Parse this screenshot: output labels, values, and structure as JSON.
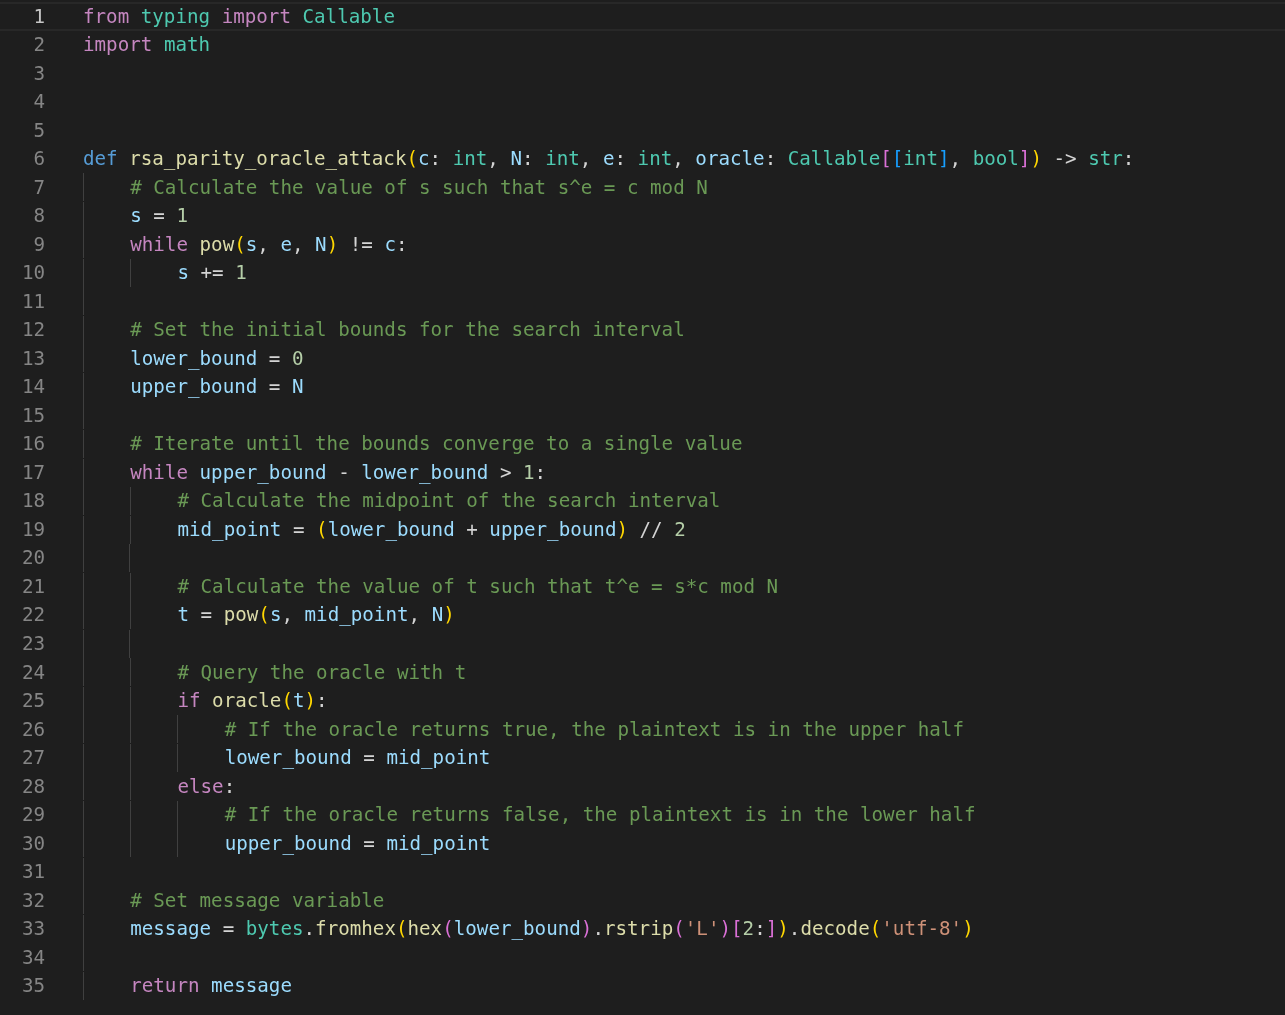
{
  "editor": {
    "lines": [
      {
        "number": "1",
        "current": true,
        "tokens": [
          {
            "kind": "kw",
            "text": "from "
          },
          {
            "kind": "type",
            "text": "typing "
          },
          {
            "kind": "kw",
            "text": "import "
          },
          {
            "kind": "type",
            "text": "Callable"
          }
        ]
      },
      {
        "number": "2",
        "current": false,
        "tokens": [
          {
            "kind": "kw",
            "text": "import "
          },
          {
            "kind": "type",
            "text": "math"
          }
        ]
      },
      {
        "number": "3",
        "current": false
      },
      {
        "number": "4",
        "current": false
      },
      {
        "number": "5",
        "current": false
      },
      {
        "number": "6",
        "current": false,
        "tokens": [
          {
            "kind": "storage",
            "text": "def "
          },
          {
            "kind": "fn",
            "text": "rsa_parity_oracle_attack"
          },
          {
            "kind": "br1",
            "text": "("
          },
          {
            "kind": "var",
            "text": "c"
          },
          {
            "kind": "op",
            "text": ": "
          },
          {
            "kind": "type",
            "text": "int"
          },
          {
            "kind": "op",
            "text": ", "
          },
          {
            "kind": "var",
            "text": "N"
          },
          {
            "kind": "op",
            "text": ": "
          },
          {
            "kind": "type",
            "text": "int"
          },
          {
            "kind": "op",
            "text": ", "
          },
          {
            "kind": "var",
            "text": "e"
          },
          {
            "kind": "op",
            "text": ": "
          },
          {
            "kind": "type",
            "text": "int"
          },
          {
            "kind": "op",
            "text": ", "
          },
          {
            "kind": "var",
            "text": "oracle"
          },
          {
            "kind": "op",
            "text": ": "
          },
          {
            "kind": "type",
            "text": "Callable"
          },
          {
            "kind": "br2",
            "text": "["
          },
          {
            "kind": "br3",
            "text": "["
          },
          {
            "kind": "type",
            "text": "int"
          },
          {
            "kind": "br3",
            "text": "]"
          },
          {
            "kind": "op",
            "text": ", "
          },
          {
            "kind": "type",
            "text": "bool"
          },
          {
            "kind": "br2",
            "text": "]"
          },
          {
            "kind": "br1",
            "text": ")"
          },
          {
            "kind": "op",
            "text": " -> "
          },
          {
            "kind": "type",
            "text": "str"
          },
          {
            "kind": "op",
            "text": ":"
          }
        ]
      },
      {
        "number": "7",
        "current": false,
        "tokens": [
          {
            "kind": "cmt",
            "text": "    # Calculate the value of s such that s^e = c mod N"
          }
        ]
      },
      {
        "number": "8",
        "current": false,
        "tokens": [
          {
            "kind": "var",
            "text": "    s"
          },
          {
            "kind": "op",
            "text": " = "
          },
          {
            "kind": "num",
            "text": "1"
          }
        ]
      },
      {
        "number": "9",
        "current": false,
        "tokens": [
          {
            "kind": "kw",
            "text": "    while "
          },
          {
            "kind": "fn",
            "text": "pow"
          },
          {
            "kind": "br1",
            "text": "("
          },
          {
            "kind": "var",
            "text": "s"
          },
          {
            "kind": "op",
            "text": ", "
          },
          {
            "kind": "var",
            "text": "e"
          },
          {
            "kind": "op",
            "text": ", "
          },
          {
            "kind": "var",
            "text": "N"
          },
          {
            "kind": "br1",
            "text": ")"
          },
          {
            "kind": "op",
            "text": " != "
          },
          {
            "kind": "var",
            "text": "c"
          },
          {
            "kind": "op",
            "text": ":"
          }
        ]
      },
      {
        "number": "10",
        "current": false,
        "tokens": [
          {
            "kind": "var",
            "text": "        s"
          },
          {
            "kind": "op",
            "text": " += "
          },
          {
            "kind": "num",
            "text": "1"
          }
        ]
      },
      {
        "number": "11",
        "current": false
      },
      {
        "number": "12",
        "current": false,
        "tokens": [
          {
            "kind": "cmt",
            "text": "    # Set the initial bounds for the search interval"
          }
        ]
      },
      {
        "number": "13",
        "current": false,
        "tokens": [
          {
            "kind": "var",
            "text": "    lower_bound"
          },
          {
            "kind": "op",
            "text": " = "
          },
          {
            "kind": "num",
            "text": "0"
          }
        ]
      },
      {
        "number": "14",
        "current": false,
        "tokens": [
          {
            "kind": "var",
            "text": "    upper_bound"
          },
          {
            "kind": "op",
            "text": " = "
          },
          {
            "kind": "var",
            "text": "N"
          }
        ]
      },
      {
        "number": "15",
        "current": false
      },
      {
        "number": "16",
        "current": false,
        "tokens": [
          {
            "kind": "cmt",
            "text": "    # Iterate until the bounds converge to a single value"
          }
        ]
      },
      {
        "number": "17",
        "current": false,
        "tokens": [
          {
            "kind": "kw",
            "text": "    while "
          },
          {
            "kind": "var",
            "text": "upper_bound"
          },
          {
            "kind": "op",
            "text": " - "
          },
          {
            "kind": "var",
            "text": "lower_bound"
          },
          {
            "kind": "op",
            "text": " > "
          },
          {
            "kind": "num",
            "text": "1"
          },
          {
            "kind": "op",
            "text": ":"
          }
        ]
      },
      {
        "number": "18",
        "current": false,
        "tokens": [
          {
            "kind": "cmt",
            "text": "        # Calculate the midpoint of the search interval"
          }
        ]
      },
      {
        "number": "19",
        "current": false,
        "tokens": [
          {
            "kind": "var",
            "text": "        mid_point"
          },
          {
            "kind": "op",
            "text": " = "
          },
          {
            "kind": "br1",
            "text": "("
          },
          {
            "kind": "var",
            "text": "lower_bound"
          },
          {
            "kind": "op",
            "text": " + "
          },
          {
            "kind": "var",
            "text": "upper_bound"
          },
          {
            "kind": "br1",
            "text": ")"
          },
          {
            "kind": "op",
            "text": " // "
          },
          {
            "kind": "num",
            "text": "2"
          }
        ]
      },
      {
        "number": "20",
        "current": false
      },
      {
        "number": "21",
        "current": false,
        "tokens": [
          {
            "kind": "cmt",
            "text": "        # Calculate the value of t such that t^e = s*c mod N"
          }
        ]
      },
      {
        "number": "22",
        "current": false,
        "tokens": [
          {
            "kind": "var",
            "text": "        t"
          },
          {
            "kind": "op",
            "text": " = "
          },
          {
            "kind": "fn",
            "text": "pow"
          },
          {
            "kind": "br1",
            "text": "("
          },
          {
            "kind": "var",
            "text": "s"
          },
          {
            "kind": "op",
            "text": ", "
          },
          {
            "kind": "var",
            "text": "mid_point"
          },
          {
            "kind": "op",
            "text": ", "
          },
          {
            "kind": "var",
            "text": "N"
          },
          {
            "kind": "br1",
            "text": ")"
          }
        ]
      },
      {
        "number": "23",
        "current": false
      },
      {
        "number": "24",
        "current": false,
        "tokens": [
          {
            "kind": "cmt",
            "text": "        # Query the oracle with t"
          }
        ]
      },
      {
        "number": "25",
        "current": false,
        "tokens": [
          {
            "kind": "kw",
            "text": "        if "
          },
          {
            "kind": "fn",
            "text": "oracle"
          },
          {
            "kind": "br1",
            "text": "("
          },
          {
            "kind": "var",
            "text": "t"
          },
          {
            "kind": "br1",
            "text": ")"
          },
          {
            "kind": "op",
            "text": ":"
          }
        ]
      },
      {
        "number": "26",
        "current": false,
        "tokens": [
          {
            "kind": "cmt",
            "text": "            # If the oracle returns true, the plaintext is in the upper half"
          }
        ]
      },
      {
        "number": "27",
        "current": false,
        "tokens": [
          {
            "kind": "var",
            "text": "            lower_bound"
          },
          {
            "kind": "op",
            "text": " = "
          },
          {
            "kind": "var",
            "text": "mid_point"
          }
        ]
      },
      {
        "number": "28",
        "current": false,
        "tokens": [
          {
            "kind": "kw",
            "text": "        else"
          },
          {
            "kind": "op",
            "text": ":"
          }
        ]
      },
      {
        "number": "29",
        "current": false,
        "tokens": [
          {
            "kind": "cmt",
            "text": "            # If the oracle returns false, the plaintext is in the lower half"
          }
        ]
      },
      {
        "number": "30",
        "current": false,
        "tokens": [
          {
            "kind": "var",
            "text": "            upper_bound"
          },
          {
            "kind": "op",
            "text": " = "
          },
          {
            "kind": "var",
            "text": "mid_point"
          }
        ]
      },
      {
        "number": "31",
        "current": false
      },
      {
        "number": "32",
        "current": false,
        "tokens": [
          {
            "kind": "cmt",
            "text": "    # Set message variable"
          }
        ]
      },
      {
        "number": "33",
        "current": false,
        "tokens": [
          {
            "kind": "var",
            "text": "    message"
          },
          {
            "kind": "op",
            "text": " = "
          },
          {
            "kind": "type",
            "text": "bytes"
          },
          {
            "kind": "op",
            "text": "."
          },
          {
            "kind": "fn",
            "text": "fromhex"
          },
          {
            "kind": "br1",
            "text": "("
          },
          {
            "kind": "fn",
            "text": "hex"
          },
          {
            "kind": "br2",
            "text": "("
          },
          {
            "kind": "var",
            "text": "lower_bound"
          },
          {
            "kind": "br2",
            "text": ")"
          },
          {
            "kind": "op",
            "text": "."
          },
          {
            "kind": "fn",
            "text": "rstrip"
          },
          {
            "kind": "br2",
            "text": "("
          },
          {
            "kind": "str",
            "text": "'L'"
          },
          {
            "kind": "br2",
            "text": ")"
          },
          {
            "kind": "br2",
            "text": "["
          },
          {
            "kind": "num",
            "text": "2"
          },
          {
            "kind": "op",
            "text": ":"
          },
          {
            "kind": "br2",
            "text": "]"
          },
          {
            "kind": "br1",
            "text": ")"
          },
          {
            "kind": "op",
            "text": "."
          },
          {
            "kind": "fn",
            "text": "decode"
          },
          {
            "kind": "br1",
            "text": "("
          },
          {
            "kind": "str",
            "text": "'utf-8'"
          },
          {
            "kind": "br1",
            "text": ")"
          }
        ]
      },
      {
        "number": "34",
        "current": false
      },
      {
        "number": "35",
        "current": false,
        "tokens": [
          {
            "kind": "kw",
            "text": "    return "
          },
          {
            "kind": "var",
            "text": "message"
          }
        ]
      }
    ]
  }
}
